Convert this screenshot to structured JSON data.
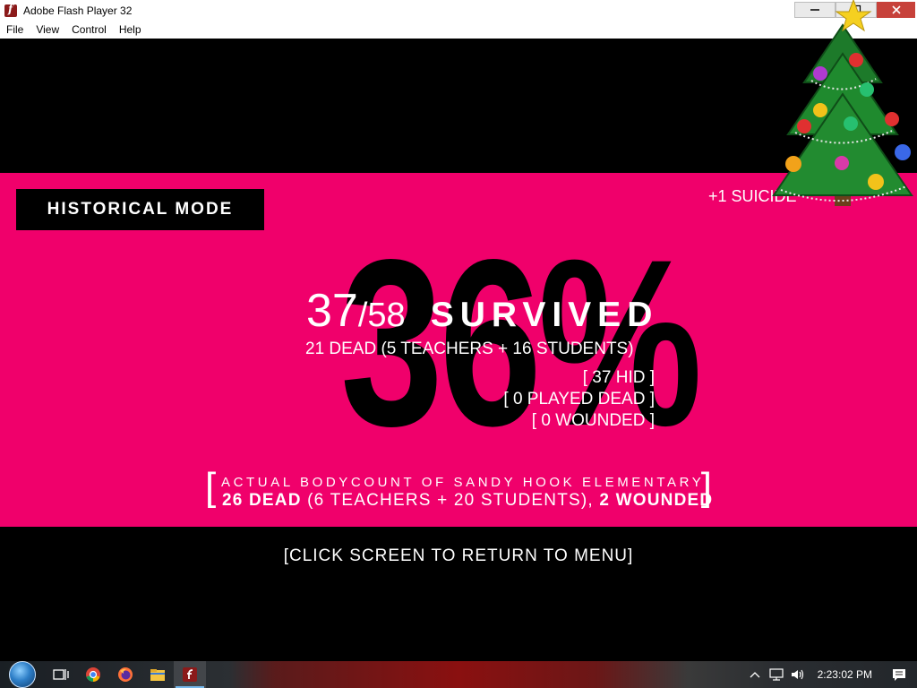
{
  "window": {
    "title": "Adobe Flash Player 32",
    "controls": {
      "minimize": "—",
      "maximize": "☐",
      "close": "✕"
    }
  },
  "menu": {
    "items": [
      "File",
      "View",
      "Control",
      "Help"
    ]
  },
  "game": {
    "mode_label": "HISTORICAL MODE",
    "suicide_note": "+1 SUICIDE",
    "big_percent": "36%",
    "survived": {
      "count": "37",
      "slash": "/",
      "total": "58",
      "word": "SURVIVED"
    },
    "dead_line": "21 DEAD (5 TEACHERS + 16 STUDENTS)",
    "stats": {
      "hid": "[ 37 HID ]",
      "played_dead": "[ 0 PLAYED DEAD ]",
      "wounded": "[ 0 WOUNDED ]"
    },
    "actual": {
      "title": "ACTUAL BODYCOUNT OF SANDY HOOK ELEMENTARY",
      "dead_bold": "26 DEAD",
      "dead_detail": " (6 TEACHERS + 20 STUDENTS), ",
      "wounded_bold": "2 WOUNDED",
      "bracket_left": "[",
      "bracket_right": "]"
    },
    "return_prompt": "[CLICK SCREEN TO RETURN TO MENU]",
    "colors": {
      "band": "#f0006b",
      "background": "#000000",
      "text": "#ffffff"
    }
  },
  "taskbar": {
    "apps": [
      "start-orb",
      "task-view-icon",
      "chrome-icon",
      "firefox-icon",
      "file-explorer-icon",
      "flash-player-icon"
    ],
    "active_app": "flash-player-icon",
    "tray_icons": [
      "chevron-up-icon",
      "network-icon",
      "volume-icon"
    ],
    "clock": "2:23:02 PM",
    "notification_icon": "action-center-icon"
  }
}
